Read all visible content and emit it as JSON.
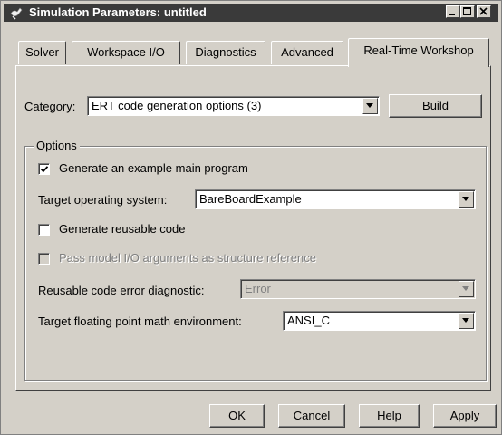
{
  "window": {
    "title": "Simulation Parameters: untitled",
    "title_bar_color": "#3a3a3a",
    "face_color": "#d4d0c8"
  },
  "tabs": [
    {
      "label": "Solver",
      "active": false
    },
    {
      "label": "Workspace I/O",
      "active": false
    },
    {
      "label": "Diagnostics",
      "active": false
    },
    {
      "label": "Advanced",
      "active": false
    },
    {
      "label": "Real-Time Workshop",
      "active": true
    }
  ],
  "category": {
    "label": "Category:",
    "value": "ERT code generation options (3)",
    "build_label": "Build"
  },
  "options": {
    "group_label": "Options",
    "generate_main": {
      "label": "Generate an example main program",
      "checked": true
    },
    "target_os": {
      "label": "Target operating system:",
      "value": "BareBoardExample"
    },
    "reusable_code": {
      "label": "Generate reusable code",
      "checked": false
    },
    "pass_model_io": {
      "label": "Pass model I/O arguments as structure reference",
      "checked": false,
      "enabled": false
    },
    "reusable_error": {
      "label": "Reusable code error diagnostic:",
      "value": "Error",
      "enabled": false
    },
    "math_env": {
      "label": "Target floating point math environment:",
      "value": "ANSI_C"
    }
  },
  "footer": {
    "ok": "OK",
    "cancel": "Cancel",
    "help": "Help",
    "apply": "Apply"
  },
  "icons": {
    "app": "simulink-icon",
    "minimize": "minimize-icon",
    "maximize": "maximize-icon",
    "close": "close-icon"
  }
}
